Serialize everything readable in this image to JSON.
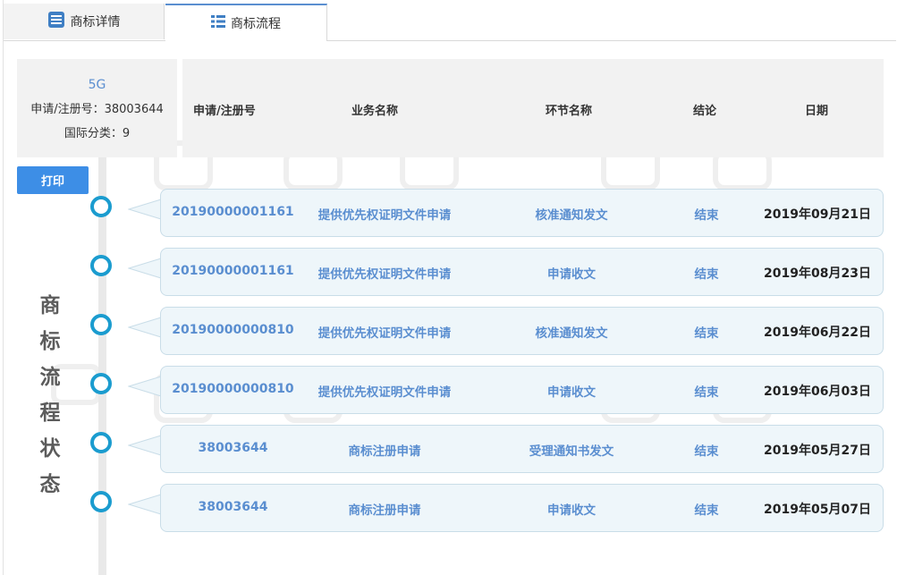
{
  "tabs": [
    {
      "label": "商标详情",
      "icon": "document-list-icon"
    },
    {
      "label": "商标流程",
      "icon": "list-icon"
    }
  ],
  "trademark": {
    "name": "5G",
    "reg_line": "申请/注册号：38003644",
    "class_line": "国际分类：9"
  },
  "columns": {
    "reg_no": "申请/注册号",
    "business": "业务名称",
    "step": "环节名称",
    "result": "结论",
    "date": "日期"
  },
  "print_label": "打印",
  "vertical_title": [
    "商",
    "标",
    "流",
    "程",
    "状",
    "态"
  ],
  "rows": [
    {
      "reg_no": "20190000001161",
      "business": "提供优先权证明文件申请",
      "step": "核准通知发文",
      "result": "结束",
      "date": "2019年09月21日"
    },
    {
      "reg_no": "20190000001161",
      "business": "提供优先权证明文件申请",
      "step": "申请收文",
      "result": "结束",
      "date": "2019年08月23日"
    },
    {
      "reg_no": "20190000000810",
      "business": "提供优先权证明文件申请",
      "step": "核准通知发文",
      "result": "结束",
      "date": "2019年06月22日"
    },
    {
      "reg_no": "20190000000810",
      "business": "提供优先权证明文件申请",
      "step": "申请收文",
      "result": "结束",
      "date": "2019年06月03日"
    },
    {
      "reg_no": "38003644",
      "business": "商标注册申请",
      "step": "受理通知书发文",
      "result": "结束",
      "date": "2019年05月27日"
    },
    {
      "reg_no": "38003644",
      "business": "商标注册申请",
      "step": "申请收文",
      "result": "结束",
      "date": "2019年05月07日"
    }
  ],
  "colors": {
    "accent_blue": "#5a8ed0",
    "node_blue": "#1b9ccf",
    "button_blue": "#3d8ee6",
    "card_bg": "#eef6fa"
  }
}
